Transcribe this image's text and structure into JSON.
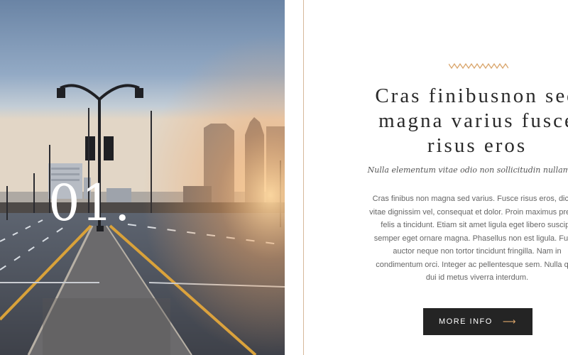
{
  "slide": {
    "number": "01."
  },
  "content": {
    "title_line1": "Cras finibusnon sed",
    "title_line2": "magna varius fusce",
    "title_line3": "risus eros",
    "subtitle": "Nulla elementum vitae odio non sollicitudin nullam nec",
    "body_lines": [
      "Cras finibus non magna sed varius. Fusce risus eros, dictum",
      "vitae dignissim vel, consequat et dolor. Proin maximus pretium",
      "felis a tincidunt. Etiam sit amet ligula eget libero suscipit",
      "semper eget ornare magna. Phasellus non est ligula. Fusce",
      "auctor neque non tortor tincidunt fringilla. Nam in",
      "condimentum orci. Integer ac pellentesque sem. Nulla quis",
      "dui id metus viverra interdum."
    ],
    "button_label": "MORE INFO",
    "button_icon": "arrow-right-icon"
  },
  "colors": {
    "accent": "#d9a46a",
    "divider": "#d6b99a",
    "button_bg": "#242424",
    "title": "#2a2a2a"
  }
}
